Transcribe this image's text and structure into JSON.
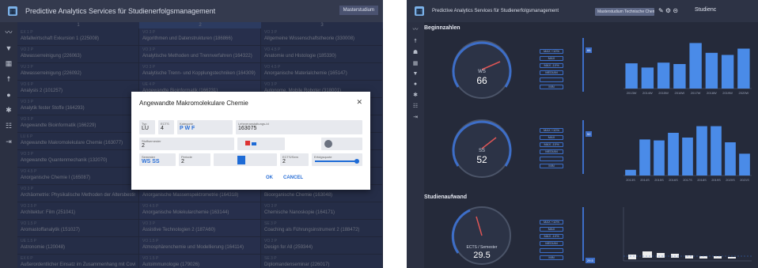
{
  "left": {
    "title": "Predictive Analytics Services für Studienerfolgsmanagement",
    "program": "Masterstudium",
    "columns": [
      "1",
      "2",
      "3"
    ],
    "rows": [
      [
        {
          "m": "EX 1 P",
          "n": "Abfallwirtschaft Exkursion 1 (225008)"
        },
        {
          "m": "VO 3 P",
          "n": "Algorithmen und Datenstrukturen (186866)"
        },
        {
          "m": "VO 3 P",
          "n": "Allgemeine Wissenschaftstheorie (330008)"
        }
      ],
      [
        {
          "m": "VO 2 P",
          "n": "Abwasserreinigung (226063)"
        },
        {
          "m": "VO 3 P",
          "n": "Analytische Methoden und Trennverfahren (164322)"
        },
        {
          "m": "VO 4.5 P",
          "n": "Anatomie und Histologie (185330)"
        }
      ],
      [
        {
          "m": "VU 3 P",
          "n": "Abwasserreinigung (226092)"
        },
        {
          "m": "VO 3 P",
          "n": "Analytische Trenn- und Kopplungstechniken (164309)"
        },
        {
          "m": "VO 4.5 P",
          "n": "Anorganische Materialchemie (165147)"
        }
      ],
      [
        {
          "m": "VO 6 P",
          "n": "Analysis 2 (101257)"
        },
        {
          "m": "UE 4 P",
          "n": "Angewandte Bioinformatik (166231)"
        },
        {
          "m": "VO 3 P",
          "n": "Autonome, Mobile Roboter (318001)"
        }
      ],
      [
        {
          "m": "VO 3 P",
          "n": "Analytik fester Stoffe (164293)"
        },
        {
          "m": "SE 2 P",
          "n": "Angewandte Ch"
        },
        {
          "m": "",
          "n": ""
        }
      ],
      [
        {
          "m": "VO 5 P",
          "n": "Angewandte Bioinformatik (166229)"
        },
        {
          "m": "VO 3 P",
          "n": "Angewandte Ge"
        },
        {
          "m": "",
          "n": ""
        }
      ],
      [
        {
          "m": "LU 6 P",
          "n": "Angewandte Makromolekulare Chemie (163077)"
        },
        {
          "m": "LU 4 P",
          "n": "Angewandte Ma"
        },
        {
          "m": "",
          "n": "antanen (1"
        }
      ],
      [
        {
          "m": "VO 3 P",
          "n": "Angewandte Quantenmechanik (132070)"
        },
        {
          "m": "VO 3 P",
          "n": "Angewandte Ma"
        },
        {
          "m": "",
          "n": ""
        }
      ],
      [
        {
          "m": "VO 4.5 P",
          "n": "Anorganische Chemie I (165087)"
        },
        {
          "m": "VO 3 P",
          "n": "Angewandte Th"
        },
        {
          "m": "",
          "n": ""
        }
      ],
      [
        {
          "m": "VO 3 P",
          "n": "Archäometrie: Physikalische Methoden der Altersbestim..."
        },
        {
          "m": "VO 2 P",
          "n": "Anorganische Massenspektrometrie (164318)"
        },
        {
          "m": "VO 3 P",
          "n": "Bioorganische Chemie (163048)"
        }
      ],
      [
        {
          "m": "VO 2.5 P",
          "n": "Architektur: Film (251041)"
        },
        {
          "m": "VO 4.5 P",
          "n": "Anorganische Molekularchemie (163144)"
        },
        {
          "m": "VO 3 P",
          "n": "Chemische Nanoskopie (164171)"
        }
      ],
      [
        {
          "m": "VO 1.5 P",
          "n": "Aromastoffanalytik (151027)"
        },
        {
          "m": "VO 3 P",
          "n": "Assistive Technologien 2 (187A60)"
        },
        {
          "m": "SE 3 P",
          "n": "Coaching als Führungsinstrument 2 (188472)"
        }
      ],
      [
        {
          "m": "UE 1.5 P",
          "n": "Astronomie (120048)"
        },
        {
          "m": "VO 1.5 P",
          "n": "Atmosphärenchemie und Modellierung (164114)"
        },
        {
          "m": "VO 2 P",
          "n": "Design for All (259344)"
        }
      ],
      [
        {
          "m": "EX 6 P",
          "n": "Außerordentlicher Einsatz im Zusammenhang mit Covid-1..."
        },
        {
          "m": "VO 1.5 P",
          "n": "Autoimmunologie (179026)"
        },
        {
          "m": "SE 3 P",
          "n": "Diplomandenseminar (226017)"
        }
      ]
    ],
    "dialog": {
      "title": "Angewandte Makromolekulare Chemie",
      "typ_label": "Typ",
      "typ": "LU",
      "ects_label": "ECTS",
      "ects": "4",
      "kategorie_label": "Kategorie",
      "kategorie": "P   W   F",
      "lva_label": "Lehrveranstaltungs-Id",
      "lva": "163075",
      "stoffsemester_label": "Stoffsemester",
      "stoffsemester": "2",
      "semester_label": "Semester",
      "semester": "WS SS",
      "periode_label": "Periode",
      "periode": "2",
      "ects_sem_label": "ECTS/Sem",
      "ects_sem": "2",
      "erfolg_label": "Erfolgsquote",
      "ok": "OK",
      "cancel": "CANCEL"
    }
  },
  "right": {
    "title": "Predictive Analytics Services für Studienerfolgsmanagement",
    "program": "Masterstudium Technische Chemie (M",
    "extra": "Studienc",
    "sec1": "Beginnzahlen",
    "sec2": "Studienaufwand",
    "gauge1_label": "WS",
    "gauge1_value": "66",
    "gauge2_label": "SS",
    "gauge2_value": "52",
    "gauge3_label": "ECTS / Semester",
    "gauge3_value": "29.5",
    "buttons": [
      "MAX +10%",
      "MAX",
      "MAX -10%",
      "MEDIAN",
      "",
      "MIN"
    ],
    "marker1": "66",
    "marker2": "52",
    "marker3": "29.5",
    "chart_data": [
      {
        "type": "bar",
        "categories": [
          "2013W",
          "2014W",
          "2015W",
          "2016W",
          "2017W",
          "2018W",
          "2019W",
          "2020W"
        ],
        "values": [
          36,
          30,
          37,
          35,
          65,
          51,
          48,
          57
        ],
        "ylim": [
          0,
          70
        ]
      },
      {
        "type": "bar",
        "categories": [
          "2013S",
          "2014S",
          "2015S",
          "2016S",
          "2017S",
          "2018S",
          "2019S",
          "2020S",
          "2021S"
        ],
        "values": [
          6,
          38,
          37,
          45,
          40,
          52,
          52,
          35,
          23
        ],
        "ylim": [
          0,
          60
        ]
      }
    ]
  }
}
